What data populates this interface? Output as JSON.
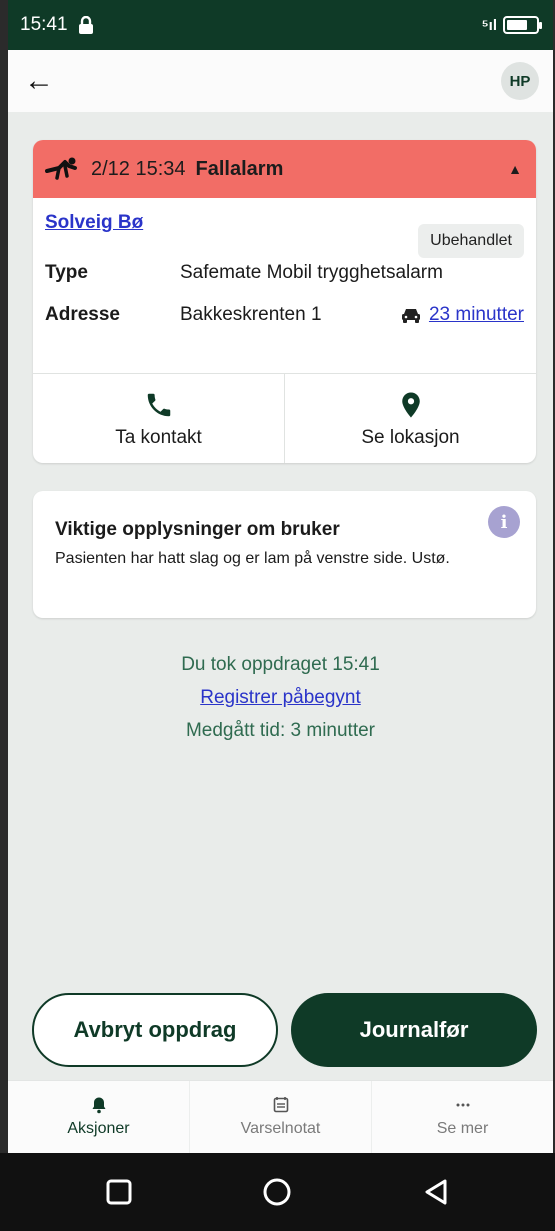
{
  "status_bar": {
    "time": "15:41",
    "signal": "⁵ıl"
  },
  "header": {
    "avatar_initials": "HP"
  },
  "alarm": {
    "datetime": "2/12 15:34",
    "title": "Fallalarm",
    "header_color": "#f26d66",
    "person_name": "Solveig Bø",
    "status": "Ubehandlet",
    "type_label": "Type",
    "type_value": "Safemate Mobil trygghetsalarm",
    "address_label": "Adresse",
    "address_value": "Bakkeskrenten 1",
    "travel_time": "23 minutter",
    "actions": [
      {
        "label": "Ta kontakt",
        "icon": "phone-icon"
      },
      {
        "label": "Se lokasjon",
        "icon": "location-pin-icon"
      }
    ]
  },
  "info": {
    "title": "Viktige opplysninger om bruker",
    "text": "Pasienten har hatt slag og er lam på venstre side. Ustø."
  },
  "assignment": {
    "taken": "Du tok oppdraget 15:41",
    "register_link": "Registrer påbegynt",
    "elapsed": "Medgått tid: 3 minutter"
  },
  "buttons": {
    "cancel": "Avbryt oppdrag",
    "journal": "Journalfør"
  },
  "tabs": [
    {
      "label": "Aksjoner",
      "icon": "bell-icon",
      "active": true
    },
    {
      "label": "Varselnotat",
      "icon": "note-icon",
      "active": false
    },
    {
      "label": "Se mer",
      "icon": "more-icon",
      "active": false
    }
  ],
  "colors": {
    "brand": "#0f3a27",
    "link": "#2a34c9",
    "alarm": "#f26d66"
  }
}
